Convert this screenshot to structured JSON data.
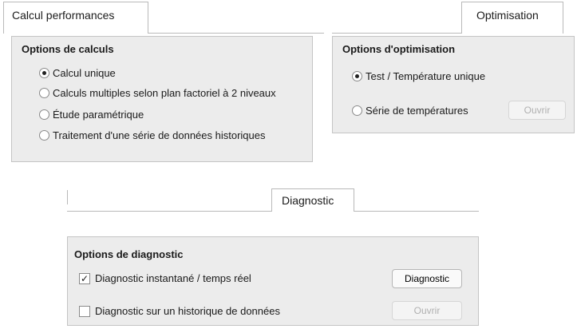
{
  "calc": {
    "tab_label": "Calcul performances",
    "group_title": "Options de calculs",
    "options": [
      {
        "label": "Calcul unique",
        "selected": true
      },
      {
        "label": "Calculs multiples selon plan factoriel à 2 niveaux",
        "selected": false
      },
      {
        "label": "Étude paramétrique",
        "selected": false
      },
      {
        "label": "Traitement d'une série de données historiques",
        "selected": false
      }
    ]
  },
  "optim": {
    "tab_label": "Optimisation",
    "group_title": "Options d'optimisation",
    "options": [
      {
        "label": "Test / Température unique",
        "selected": true
      },
      {
        "label": "Série de températures",
        "selected": false
      }
    ],
    "open_button": "Ouvrir"
  },
  "diag": {
    "tab_label": "Diagnostic",
    "group_title": "Options de diagnostic",
    "options": [
      {
        "label": "Diagnostic instantané / temps réel",
        "checked": true
      },
      {
        "label": "Diagnostic sur un historique de données",
        "checked": false
      }
    ],
    "diagnostic_button": "Diagnostic",
    "open_button": "Ouvrir"
  }
}
